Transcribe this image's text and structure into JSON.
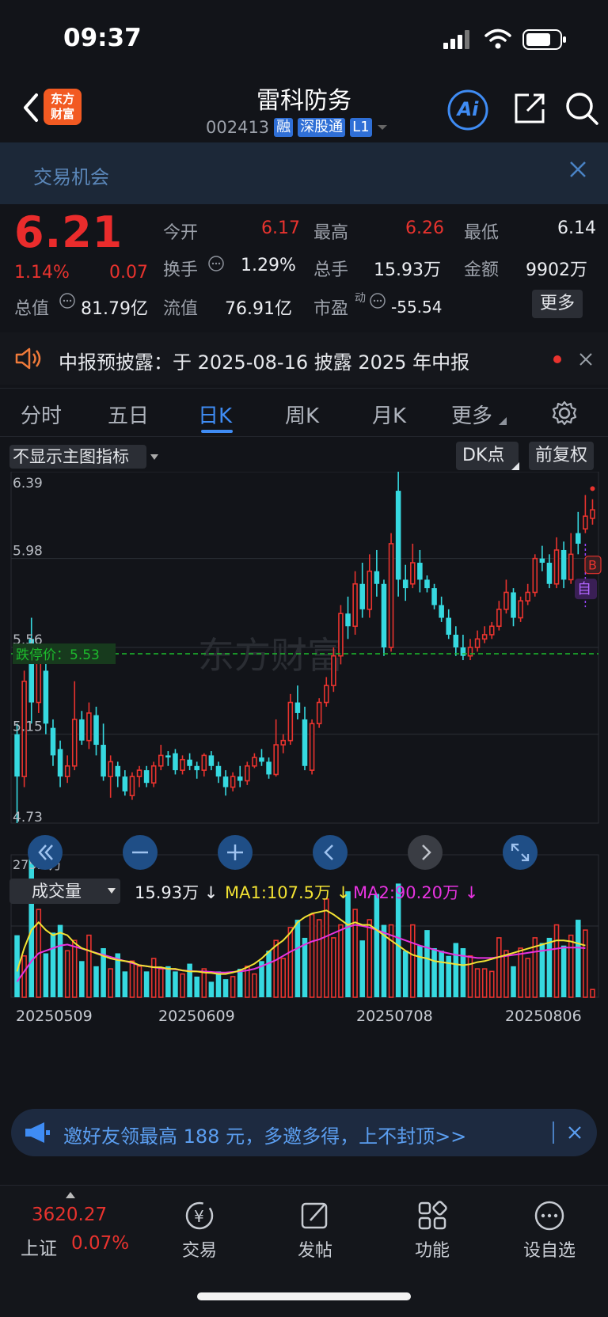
{
  "status_bar": {
    "time": "09:37"
  },
  "header": {
    "logo_line1": "东方",
    "logo_line2": "财富",
    "title": "雷科防务",
    "code": "002413",
    "tags": [
      "融",
      "深股通",
      "L1"
    ],
    "ai_label": "Ai"
  },
  "opportunity": {
    "label": "交易机会"
  },
  "quote": {
    "price": "6.21",
    "change_pct": "1.14%",
    "change_amt": "0.07",
    "open_label": "今开",
    "open_value": "6.17",
    "high_label": "最高",
    "high_value": "6.26",
    "low_label": "最低",
    "low_value": "6.14",
    "turnover_label": "换手",
    "turnover_value": "1.29%",
    "volume_label": "总手",
    "volume_value": "15.93万",
    "amount_label": "金额",
    "amount_value": "9902万",
    "mktcap_label": "总值",
    "mktcap_value": "81.79亿",
    "float_label": "流值",
    "float_value": "76.91亿",
    "pe_label": "市盈",
    "pe_sup": "动",
    "pe_value": "-55.54",
    "more_label": "更多"
  },
  "announcement": {
    "text": "中报预披露：于 2025-08-16 披露 2025 年中报"
  },
  "tabs": [
    "分时",
    "五日",
    "日K",
    "周K",
    "月K",
    "更多"
  ],
  "chart_controls": {
    "indicator_select": "不显示主图指标",
    "dk_label": "DK点",
    "adjust_label": "前复权"
  },
  "colors": {
    "up": "#e8332e",
    "down": "#36d9e0",
    "ma1": "#f2e233",
    "ma2": "#e733e0",
    "limit_down": "#1dbb2d",
    "accent": "#3f8cf4"
  },
  "chart_data": {
    "type": "candlestick",
    "price_axis_ticks": [
      "6.39",
      "5.98",
      "5.56",
      "5.15",
      "4.73"
    ],
    "ylim": [
      4.73,
      6.39
    ],
    "limit_down_label": "跌停价：5.53",
    "limit_down_price": 5.53,
    "watermark": "东方财富",
    "markers": [
      "B",
      "自"
    ],
    "candles": [
      [
        5.15,
        4.95,
        5.2,
        4.73
      ],
      [
        4.95,
        5.4,
        5.45,
        4.9
      ],
      [
        5.6,
        5.3,
        5.7,
        5.2
      ],
      [
        5.3,
        5.52,
        5.55,
        5.25
      ],
      [
        5.45,
        5.2,
        5.5,
        5.15
      ],
      [
        5.18,
        5.05,
        5.22,
        5.0
      ],
      [
        5.08,
        4.95,
        5.12,
        4.9
      ],
      [
        4.95,
        5.0,
        5.05,
        4.92
      ],
      [
        5.0,
        5.22,
        5.4,
        4.98
      ],
      [
        5.22,
        5.12,
        5.26,
        5.1
      ],
      [
        5.12,
        5.25,
        5.3,
        5.08
      ],
      [
        5.24,
        5.1,
        5.28,
        5.05
      ],
      [
        5.1,
        4.95,
        5.2,
        4.93
      ],
      [
        4.95,
        5.02,
        5.05,
        4.85
      ],
      [
        5.0,
        4.95,
        5.02,
        4.9
      ],
      [
        4.95,
        4.88,
        4.98,
        4.86
      ],
      [
        4.86,
        4.95,
        4.97,
        4.84
      ],
      [
        4.95,
        4.98,
        5.0,
        4.9
      ],
      [
        4.98,
        4.92,
        5.0,
        4.9
      ],
      [
        4.92,
        5.0,
        5.02,
        4.9
      ],
      [
        5.0,
        5.05,
        5.1,
        4.98
      ],
      [
        5.05,
        5.04,
        5.07,
        5.0
      ],
      [
        5.06,
        4.98,
        5.08,
        4.96
      ],
      [
        4.98,
        5.03,
        5.05,
        4.96
      ],
      [
        5.03,
        5.0,
        5.06,
        4.98
      ],
      [
        5.0,
        4.98,
        5.02,
        4.94
      ],
      [
        4.98,
        5.05,
        5.06,
        4.95
      ],
      [
        5.05,
        5.0,
        5.07,
        4.98
      ],
      [
        5.0,
        4.95,
        5.02,
        4.92
      ],
      [
        4.95,
        4.9,
        4.98,
        4.86
      ],
      [
        4.9,
        4.95,
        4.97,
        4.88
      ],
      [
        4.95,
        4.93,
        5.0,
        4.9
      ],
      [
        4.93,
        5.0,
        5.02,
        4.91
      ],
      [
        5.0,
        5.04,
        5.06,
        4.99
      ],
      [
        5.04,
        5.02,
        5.08,
        5.0
      ],
      [
        5.02,
        4.96,
        5.04,
        4.94
      ],
      [
        4.96,
        5.1,
        5.22,
        4.95
      ],
      [
        5.1,
        5.12,
        5.15,
        5.06
      ],
      [
        5.12,
        5.3,
        5.34,
        5.1
      ],
      [
        5.3,
        5.25,
        5.38,
        5.22
      ],
      [
        5.22,
        5.0,
        5.28,
        4.98
      ],
      [
        4.98,
        5.2,
        5.22,
        4.96
      ],
      [
        5.2,
        5.3,
        5.32,
        5.18
      ],
      [
        5.3,
        5.38,
        5.42,
        5.28
      ],
      [
        5.38,
        5.52,
        5.56,
        5.35
      ],
      [
        5.52,
        5.72,
        5.76,
        5.48
      ],
      [
        5.72,
        5.66,
        5.8,
        5.6
      ],
      [
        5.66,
        5.86,
        5.92,
        5.62
      ],
      [
        5.86,
        5.74,
        5.96,
        5.7
      ],
      [
        5.74,
        5.92,
        6.0,
        5.7
      ],
      [
        5.92,
        5.86,
        6.02,
        5.8
      ],
      [
        5.86,
        5.56,
        5.88,
        5.52
      ],
      [
        5.56,
        6.05,
        6.1,
        5.54
      ],
      [
        6.3,
        5.88,
        6.39,
        5.8
      ],
      [
        5.88,
        5.84,
        5.95,
        5.78
      ],
      [
        5.86,
        5.96,
        6.05,
        5.84
      ],
      [
        5.96,
        5.88,
        6.02,
        5.82
      ],
      [
        5.88,
        5.84,
        5.9,
        5.82
      ],
      [
        5.84,
        5.76,
        5.86,
        5.74
      ],
      [
        5.76,
        5.7,
        5.8,
        5.68
      ],
      [
        5.7,
        5.62,
        5.74,
        5.6
      ],
      [
        5.62,
        5.56,
        5.66,
        5.52
      ],
      [
        5.56,
        5.52,
        5.62,
        5.5
      ],
      [
        5.52,
        5.56,
        5.6,
        5.5
      ],
      [
        5.56,
        5.6,
        5.64,
        5.54
      ],
      [
        5.6,
        5.62,
        5.66,
        5.58
      ],
      [
        5.62,
        5.66,
        5.68,
        5.6
      ],
      [
        5.66,
        5.74,
        5.78,
        5.64
      ],
      [
        5.74,
        5.82,
        5.88,
        5.72
      ],
      [
        5.82,
        5.7,
        5.84,
        5.66
      ],
      [
        5.7,
        5.78,
        5.8,
        5.68
      ],
      [
        5.78,
        5.82,
        5.86,
        5.76
      ],
      [
        5.82,
        5.98,
        6.0,
        5.8
      ],
      [
        5.98,
        5.96,
        6.04,
        5.92
      ],
      [
        5.96,
        5.86,
        6.0,
        5.84
      ],
      [
        5.86,
        6.02,
        6.08,
        5.84
      ],
      [
        6.02,
        5.88,
        6.06,
        5.84
      ],
      [
        5.88,
        6.0,
        6.1,
        5.86
      ],
      [
        6.1,
        6.05,
        6.2,
        6.0
      ],
      [
        6.12,
        6.18,
        6.28,
        6.1
      ],
      [
        6.17,
        6.21,
        6.26,
        6.14
      ]
    ],
    "volume": {
      "label": "成交量",
      "current": "15.93万",
      "ma1_label": "MA1:107.5万",
      "ma2_label": "MA2:90.20万",
      "axis_top": "275.7万",
      "ymax": 275.7,
      "bars": [
        120,
        80,
        270,
        170,
        85,
        125,
        140,
        90,
        110,
        70,
        120,
        60,
        95,
        55,
        85,
        50,
        70,
        60,
        50,
        75,
        55,
        60,
        50,
        45,
        65,
        40,
        55,
        30,
        50,
        35,
        40,
        55,
        60,
        45,
        70,
        90,
        110,
        75,
        135,
        150,
        115,
        160,
        150,
        190,
        115,
        140,
        205,
        170,
        110,
        150,
        200,
        140,
        140,
        220,
        90,
        140,
        100,
        130,
        95,
        90,
        80,
        105,
        95,
        80,
        55,
        55,
        50,
        115,
        90,
        60,
        95,
        75,
        115,
        105,
        115,
        140,
        100,
        120,
        150,
        130,
        15
      ],
      "ma1": [
        50,
        95,
        130,
        145,
        130,
        120,
        125,
        120,
        105,
        95,
        90,
        85,
        80,
        75,
        72,
        70,
        68,
        62,
        60,
        58,
        58,
        55,
        55,
        52,
        50,
        50,
        48,
        47,
        45,
        45,
        48,
        52,
        58,
        65,
        75,
        88,
        100,
        110,
        125,
        145,
        155,
        162,
        165,
        168,
        160,
        150,
        140,
        145,
        140,
        140,
        130,
        120,
        110,
        100,
        90,
        82,
        78,
        75,
        70,
        68,
        66,
        64,
        62,
        64,
        68,
        70,
        74,
        78,
        82,
        86,
        90,
        94,
        98,
        102,
        106,
        110,
        110,
        108,
        104,
        100
      ],
      "ma2": [
        30,
        50,
        70,
        85,
        90,
        95,
        100,
        102,
        98,
        94,
        90,
        86,
        82,
        78,
        74,
        70,
        66,
        62,
        60,
        58,
        56,
        55,
        54,
        52,
        51,
        50,
        50,
        49,
        48,
        48,
        49,
        50,
        52,
        55,
        60,
        66,
        72,
        80,
        88,
        95,
        102,
        108,
        112,
        118,
        124,
        130,
        136,
        140,
        138,
        135,
        130,
        125,
        120,
        115,
        110,
        105,
        100,
        96,
        92,
        88,
        85,
        82,
        80,
        78,
        76,
        76,
        76,
        78,
        80,
        82,
        84,
        86,
        88,
        90,
        92,
        94,
        96,
        96,
        96,
        95
      ]
    },
    "date_labels": [
      "20250509",
      "20250609",
      "20250708",
      "20250806"
    ]
  },
  "promo": {
    "text": "邀好友领最高 188 元，多邀多得，上不封顶>>"
  },
  "bottom_nav": {
    "index_value": "3620.27",
    "index_name": "上证",
    "index_change": "0.07%",
    "items": [
      "交易",
      "发帖",
      "功能",
      "设自选"
    ]
  }
}
